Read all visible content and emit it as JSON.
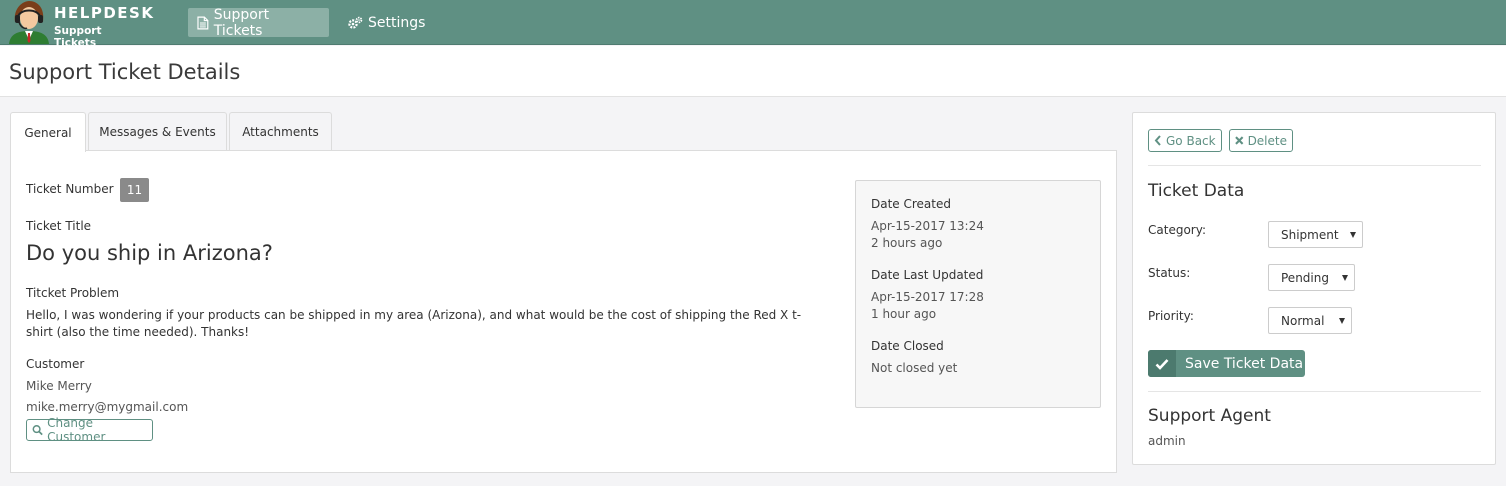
{
  "brand": {
    "line1": "HELPDESK",
    "line2": "Support Tickets"
  },
  "nav": {
    "items": [
      {
        "label": "Support Tickets",
        "icon": "document-icon",
        "active": true
      },
      {
        "label": "Settings",
        "icon": "gears-icon",
        "active": false
      }
    ]
  },
  "page": {
    "title": "Support Ticket Details"
  },
  "tabs": [
    {
      "label": "General",
      "active": true
    },
    {
      "label": "Messages & Events",
      "active": false
    },
    {
      "label": "Attachments",
      "active": false
    }
  ],
  "general": {
    "ticket_number_label": "Ticket Number",
    "ticket_number": "11",
    "ticket_title_label": "Ticket Title",
    "ticket_title": "Do you ship in Arizona?",
    "problem_label": "Titcket Problem",
    "problem_text": "Hello, I was wondering if your products can be shipped in my area (Arizona), and what would be the cost of shipping the Red X t-shirt (also the time needed). Thanks!",
    "customer_label": "Customer",
    "customer_name": "Mike Merry",
    "customer_email": "mike.merry@mygmail.com",
    "change_customer_label": "Change Customer"
  },
  "dates": {
    "created_label": "Date Created",
    "created_value": "Apr-15-2017 13:24",
    "created_relative": "2 hours ago",
    "updated_label": "Date Last Updated",
    "updated_value": "Apr-15-2017 17:28",
    "updated_relative": "1 hour ago",
    "closed_label": "Date Closed",
    "closed_value": "Not closed yet"
  },
  "side": {
    "go_back_label": "Go Back",
    "delete_label": "Delete",
    "ticket_data_title": "Ticket Data",
    "category_label": "Category:",
    "category_value": "Shipment",
    "status_label": "Status:",
    "status_value": "Pending",
    "priority_label": "Priority:",
    "priority_value": "Normal",
    "save_label": "Save Ticket Data",
    "agent_title": "Support Agent",
    "agent_value": "admin"
  },
  "colors": {
    "navbar": "#5f9083",
    "nav_active": "#8cb0a6",
    "accent": "#5f9083",
    "badge": "#8a8a8a"
  }
}
